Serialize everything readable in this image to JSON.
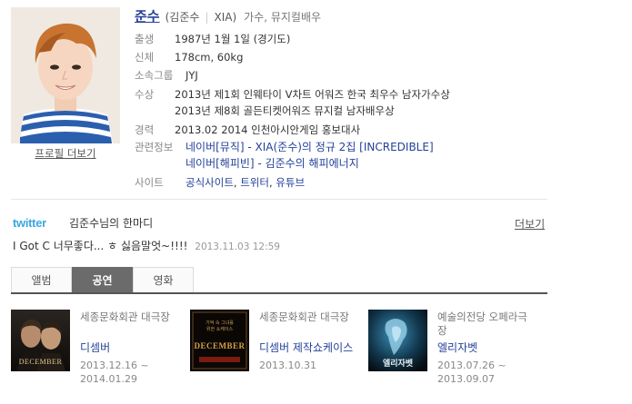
{
  "profile": {
    "name": "준수",
    "name_full": "(김준수",
    "alias": "XIA)",
    "job": "가수, 뮤지컬배우",
    "more_link": "프로필 더보기",
    "rows": [
      {
        "label": "출생",
        "value": "1987년 1월 1일 (경기도)"
      },
      {
        "label": "신체",
        "value": "178cm, 60kg"
      },
      {
        "label": "소속그룹",
        "value": "JYJ"
      }
    ],
    "awards_label": "수상",
    "awards": [
      "2013년 제1회 인웨타이 V차트 어워즈 한국 최우수 남자가수상",
      "2013년 제8회 골든티켓어워즈 뮤지컬 남자배우상"
    ],
    "career_label": "경력",
    "career": "2013.02 2014 인천아시안게임 홍보대사",
    "related_label": "관련정보",
    "related": [
      "네이버[뮤직] - XIA(준수)의 정규 2집 [INCREDIBLE]",
      "네이버[해피빈] - 김준수의 해피에너지"
    ],
    "site_label": "사이트",
    "sites": [
      "공식사이트",
      "트위터",
      "유튜브"
    ]
  },
  "twitter": {
    "logo": "twitter",
    "title": "김준수님의 한마디",
    "more": "더보기",
    "text": "I Got C 너무좋다... ㅎ 싫음말엇~!!!!",
    "time": "2013.11.03 12:59"
  },
  "tabs": [
    "앨범",
    "공연",
    "영화"
  ],
  "active_tab": "공연",
  "cards": [
    {
      "venue": "세종문화회관 대극장",
      "title": "디셈버",
      "date": "2013.12.16 ~ 2014.01.29",
      "poster_text": "DECEMBER"
    },
    {
      "venue": "세종문화회관 대극장",
      "title": "디셈버 제작쇼케이스",
      "date": "2013.10.31",
      "poster_text": "DECEMBER"
    },
    {
      "venue": "예술의전당 오페라극장",
      "title": "엘리자벳",
      "date": "2013.07.26 ~ 2013.09.07",
      "poster_text": "엘리자벳"
    }
  ],
  "colors": {
    "link": "#24419a",
    "twitter": "#3aa8e2",
    "tab_active": "#6b6b6b"
  }
}
